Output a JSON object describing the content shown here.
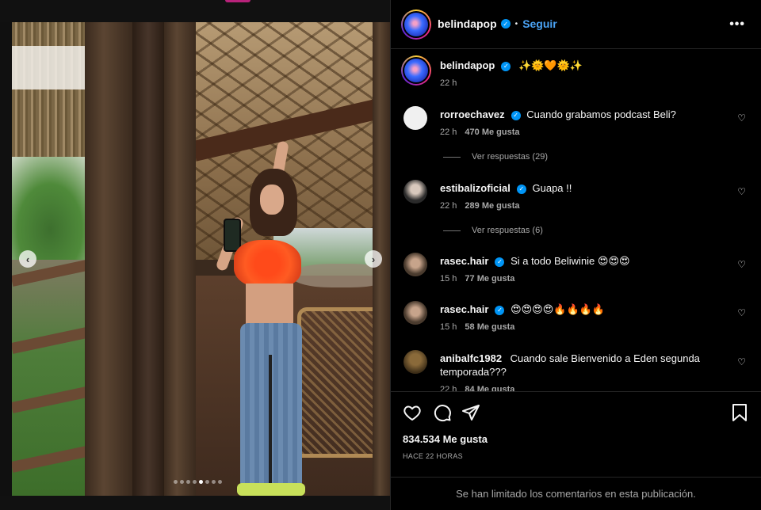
{
  "post": {
    "author": "belindapop",
    "follow_label": "Seguir",
    "bullet": "•",
    "caption": "✨🌞🧡🌞✨",
    "caption_time": "22 h",
    "image_dots": 8,
    "active_dot": 4
  },
  "comments": [
    {
      "username": "rorroechavez",
      "verified": true,
      "text": "Cuando grabamos podcast Beli?",
      "time": "22 h",
      "likes": "470 Me gusta",
      "replies": "Ver respuestas (29)"
    },
    {
      "username": "estibalizoficial",
      "verified": true,
      "text": "Guapa !!",
      "time": "22 h",
      "likes": "289 Me gusta",
      "replies": "Ver respuestas (6)"
    },
    {
      "username": "rasec.hair",
      "verified": true,
      "text": "Si a todo Beliwinie 😍😍😍",
      "time": "15 h",
      "likes": "77 Me gusta"
    },
    {
      "username": "rasec.hair",
      "verified": true,
      "text": "😍😍😍😍🔥🔥🔥🔥",
      "time": "15 h",
      "likes": "58 Me gusta"
    },
    {
      "username": "anibalfc1982",
      "verified": false,
      "text": "Cuando sale Bienvenido a Eden segunda temporada???",
      "time": "22 h",
      "likes": "84 Me gusta"
    }
  ],
  "footer": {
    "likes_count": "834.534 Me gusta",
    "time_ago": "HACE 22 HORAS",
    "limited_comments": "Se han limitado los comentarios en esta publicación."
  },
  "colors": {
    "accent_blue": "#0095f6",
    "link_blue": "#4aa3f5",
    "background": "#000000"
  }
}
